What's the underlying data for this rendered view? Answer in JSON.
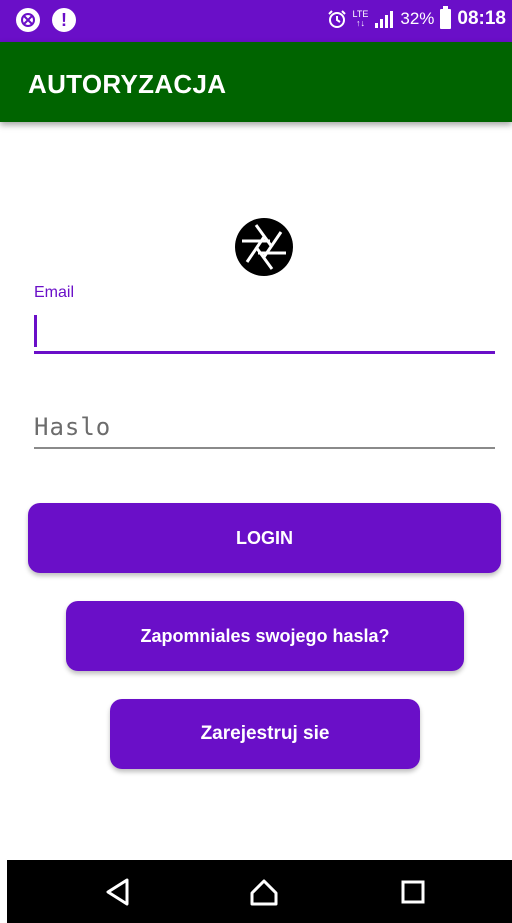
{
  "status_bar": {
    "battery": "32%",
    "time": "08:18",
    "network": "LTE",
    "icons": [
      "antivirus-icon",
      "alert-icon",
      "alarm-icon",
      "signal-icon",
      "battery-icon"
    ]
  },
  "app_bar": {
    "title": "AUTORYZACJA"
  },
  "logo": {
    "icon": "camera-aperture-icon"
  },
  "form": {
    "email_label": "Email",
    "email_value": "",
    "password_placeholder": "Haslo"
  },
  "buttons": {
    "login": "LOGIN",
    "forgot": "Zapomniales swojego hasla?",
    "register": "Zarejestruj sie"
  },
  "nav": {
    "icons": [
      "back-icon",
      "home-icon",
      "recents-icon"
    ]
  },
  "colors": {
    "primary": "#6a0fc8",
    "app_bar": "#006400",
    "nav_bar": "#000000"
  }
}
